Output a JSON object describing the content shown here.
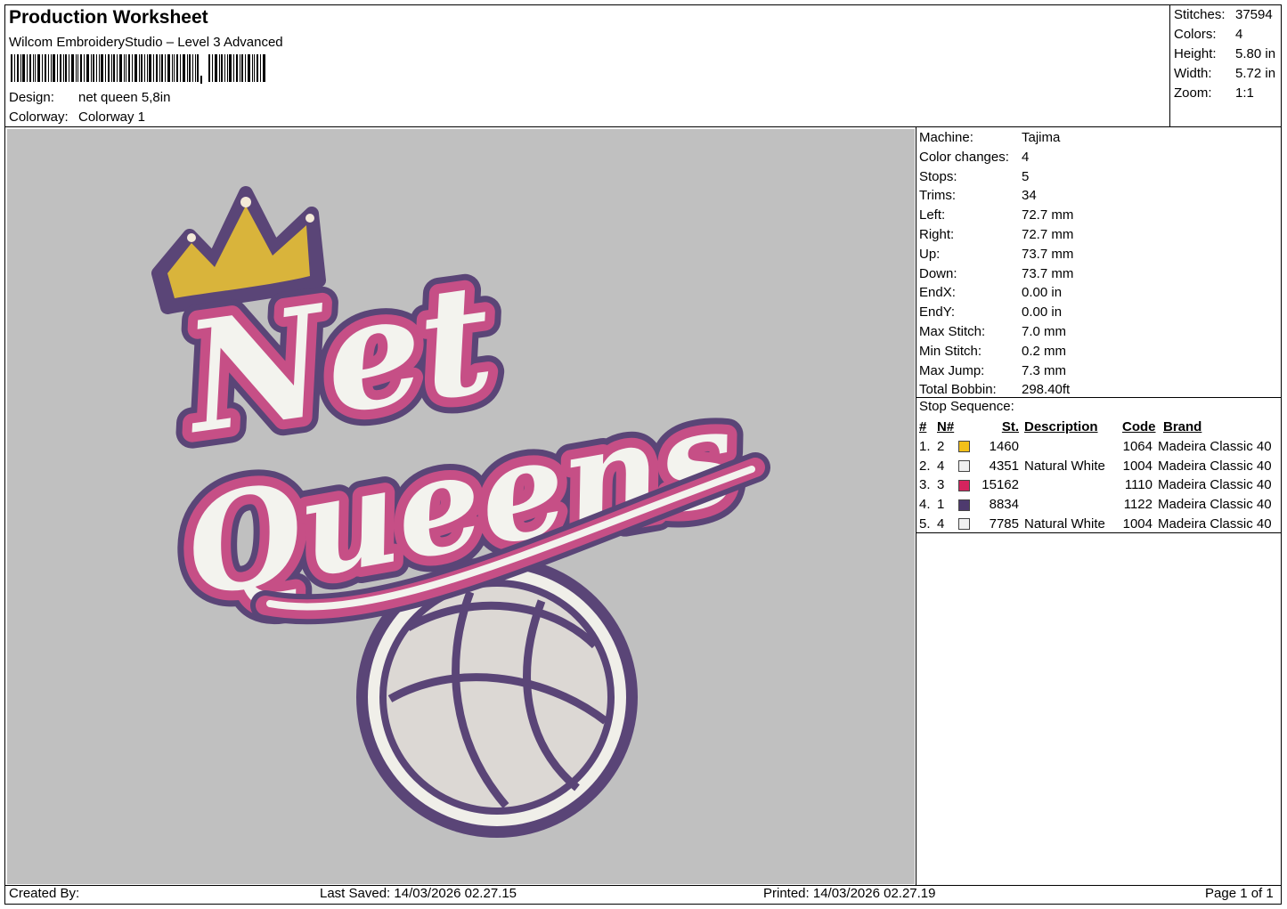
{
  "header": {
    "title": "Production Worksheet",
    "software": "Wilcom EmbroideryStudio – Level 3 Advanced",
    "design_label": "Design:",
    "design_value": "net queen 5,8in",
    "colorway_label": "Colorway:",
    "colorway_value": "Colorway 1"
  },
  "summary": [
    {
      "label": "Stitches:",
      "value": "37594"
    },
    {
      "label": "Colors:",
      "value": "4"
    },
    {
      "label": "Height:",
      "value": "5.80 in"
    },
    {
      "label": "Width:",
      "value": "5.72 in"
    },
    {
      "label": "Zoom:",
      "value": "1:1"
    }
  ],
  "properties": [
    {
      "label": "Machine:",
      "value": "Tajima"
    },
    {
      "label": "Color changes:",
      "value": "4"
    },
    {
      "label": "Stops:",
      "value": "5"
    },
    {
      "label": "Trims:",
      "value": "34"
    },
    {
      "label": "Left:",
      "value": "72.7 mm"
    },
    {
      "label": "Right:",
      "value": "72.7 mm"
    },
    {
      "label": "Up:",
      "value": "73.7 mm"
    },
    {
      "label": "Down:",
      "value": "73.7 mm"
    },
    {
      "label": "EndX:",
      "value": "0.00 in"
    },
    {
      "label": "EndY:",
      "value": "0.00 in"
    },
    {
      "label": "Max Stitch:",
      "value": "7.0 mm"
    },
    {
      "label": "Min Stitch:",
      "value": "0.2 mm"
    },
    {
      "label": "Max Jump:",
      "value": "7.3 mm"
    },
    {
      "label": "Total Bobbin:",
      "value": "298.40ft"
    }
  ],
  "stop_sequence": {
    "title": "Stop Sequence:",
    "headers": {
      "num": "#",
      "n": "N#",
      "st": "St.",
      "desc": "Description",
      "code": "Code",
      "brand": "Brand"
    },
    "rows": [
      {
        "num": "1.",
        "n": "2",
        "color": "#f2c01a",
        "st": "1460",
        "desc": "",
        "code": "1064",
        "brand": "Madeira Classic 40"
      },
      {
        "num": "2.",
        "n": "4",
        "color": "#f0f0f0",
        "st": "4351",
        "desc": "Natural White",
        "code": "1004",
        "brand": "Madeira Classic 40"
      },
      {
        "num": "3.",
        "n": "3",
        "color": "#d4245e",
        "st": "15162",
        "desc": "",
        "code": "1110",
        "brand": "Madeira Classic 40"
      },
      {
        "num": "4.",
        "n": "1",
        "color": "#4e3a6e",
        "st": "8834",
        "desc": "",
        "code": "1122",
        "brand": "Madeira Classic 40"
      },
      {
        "num": "5.",
        "n": "4",
        "color": "#f0f0f0",
        "st": "7785",
        "desc": "Natural White",
        "code": "1004",
        "brand": "Madeira Classic 40"
      }
    ]
  },
  "design_art": {
    "line1": "Net",
    "line2": "Queens"
  },
  "footer": {
    "created_by": "Created By:",
    "last_saved": "Last Saved: 14/03/2026 02.27.15",
    "printed": "Printed: 14/03/2026 02.27.19",
    "page": "Page 1 of 1"
  }
}
